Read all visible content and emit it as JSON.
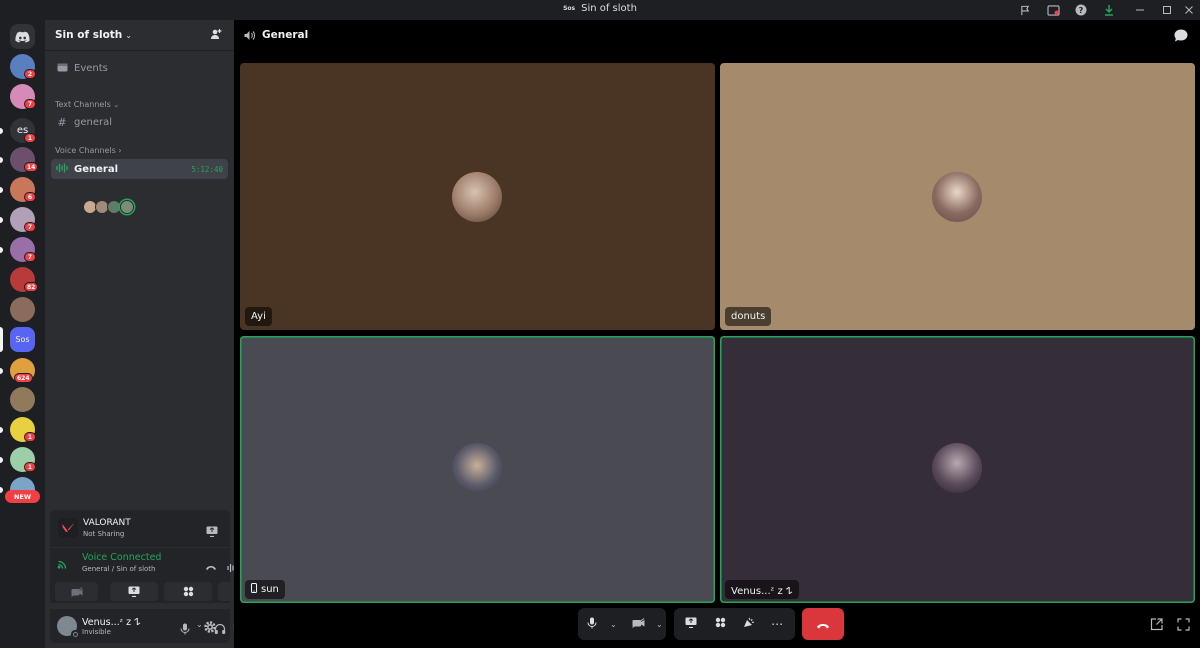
{
  "window": {
    "title": "Sin of sloth",
    "title_icon_text": "Sos"
  },
  "rail": {
    "new_label": "NEW",
    "servers": [
      {
        "name": "server-1",
        "badge": "2",
        "color": "#5a7fbf"
      },
      {
        "name": "server-2",
        "badge": "7",
        "color": "#d68ab8"
      },
      {
        "name": "server-es",
        "text": "es",
        "badge": "1",
        "color": "#313338"
      },
      {
        "name": "server-4",
        "badge": "14",
        "color": "#6b4f6d"
      },
      {
        "name": "server-5",
        "badge": "6",
        "color": "#c9775b"
      },
      {
        "name": "server-6",
        "badge": "7",
        "color": "#b0a0b8"
      },
      {
        "name": "server-7",
        "badge": "7",
        "color": "#9a6fa8"
      },
      {
        "name": "server-8",
        "badge": "82",
        "color": "#b83a3a"
      },
      {
        "name": "server-9",
        "badge": "",
        "color": "#8b6b5b"
      },
      {
        "name": "server-sos",
        "text": "Sos",
        "badge": "",
        "color": "#5865f2"
      },
      {
        "name": "server-11",
        "badge": "624",
        "color": "#e0a040"
      },
      {
        "name": "server-12",
        "badge": "",
        "color": "#8f7a5c"
      },
      {
        "name": "server-13",
        "badge": "1",
        "color": "#e8d040"
      },
      {
        "name": "server-14",
        "badge": "1",
        "color": "#9ccfa8"
      },
      {
        "name": "server-15",
        "badge": "",
        "color": "#7ba4c8"
      }
    ]
  },
  "sidebar": {
    "server_name": "Sin of sloth",
    "events_label": "Events",
    "text_category": "Text Channels",
    "text_channel": "general",
    "voice_category": "Voice Channels",
    "voice_channel": "General",
    "voice_timer": "5:12:40",
    "activity": {
      "game": "VALORANT",
      "status": "Not Sharing"
    },
    "voice": {
      "status": "Voice Connected",
      "location": "General / Sin of sloth"
    },
    "user": {
      "name": "Venus...ᶻ z 𐰁",
      "status": "Invisible"
    }
  },
  "main": {
    "channel_title": "General",
    "tiles": [
      {
        "name": "Ayi",
        "bg": "#4a3525",
        "speaking": false
      },
      {
        "name": "donuts",
        "bg": "#a58a6c",
        "speaking": false
      },
      {
        "name": "sun",
        "bg": "#4a4a52",
        "speaking": true,
        "mobile": true
      },
      {
        "name": "Venus...ᶻ z 𐰁",
        "bg": "#352e39",
        "speaking": true
      }
    ]
  },
  "colors": {
    "accent_green": "#23a55a",
    "hangup_red": "#da373c",
    "blurple": "#5865f2"
  }
}
